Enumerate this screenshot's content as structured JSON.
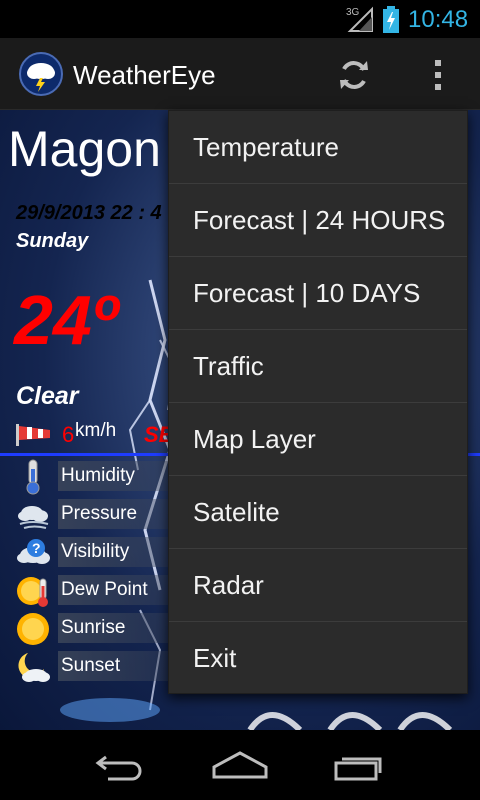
{
  "status_bar": {
    "network_label": "3G",
    "time": "10:48"
  },
  "action_bar": {
    "app_title": "WeatherEye",
    "app_icon": "storm-cloud-icon",
    "refresh_icon": "refresh-icon",
    "overflow_icon": "overflow-menu-icon"
  },
  "weather": {
    "city": "Magon",
    "datetime": "29/9/2013 22 : 4",
    "day": "Sunday",
    "temperature": "24º",
    "condition": "Clear",
    "wind_speed": "6",
    "wind_unit": "km/h",
    "wind_direction": "SE"
  },
  "details": [
    {
      "label": "Humidity",
      "icon": "thermometer-icon"
    },
    {
      "label": "Pressure",
      "icon": "cloud-wind-icon"
    },
    {
      "label": "Visibility",
      "icon": "cloud-question-icon"
    },
    {
      "label": "Dew Point",
      "icon": "sun-thermometer-icon"
    },
    {
      "label": "Sunrise",
      "icon": "sun-icon"
    },
    {
      "label": "Sunset",
      "icon": "moon-cloud-icon"
    }
  ],
  "menu": {
    "items": [
      {
        "label": "Temperature"
      },
      {
        "label": "Forecast | 24 HOURS"
      },
      {
        "label": "Forecast | 10 DAYS"
      },
      {
        "label": "Traffic"
      },
      {
        "label": "Map Layer"
      },
      {
        "label": "Satelite"
      },
      {
        "label": "Radar"
      },
      {
        "label": "Exit"
      }
    ]
  },
  "nav_bar": {
    "back_icon": "back-icon",
    "home_icon": "home-icon",
    "recents_icon": "recent-apps-icon"
  },
  "colors": {
    "accent": "#33b5e5",
    "temperature": "#ff0000",
    "divider": "#1e3cff",
    "menu_bg": "#2b2b2b"
  }
}
